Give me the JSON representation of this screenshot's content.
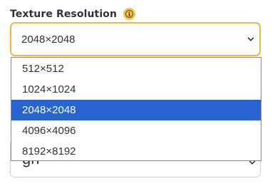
{
  "field": {
    "label": "Texture Resolution",
    "info_glyph": "i",
    "info_icon": "info-icon",
    "selected_value": "2048×2048"
  },
  "colors": {
    "focus_border": "#f0b541",
    "info_badge": "#f6c24a",
    "selected_option_bg": "#2864cf"
  },
  "dropdown": {
    "options": [
      {
        "label": "512×512",
        "selected": false
      },
      {
        "label": "1024×1024",
        "selected": false
      },
      {
        "label": "2048×2048",
        "selected": true
      },
      {
        "label": "4096×4096",
        "selected": false
      },
      {
        "label": "8192×8192",
        "selected": false
      }
    ]
  },
  "next_field": {
    "partial_value": "gn"
  }
}
